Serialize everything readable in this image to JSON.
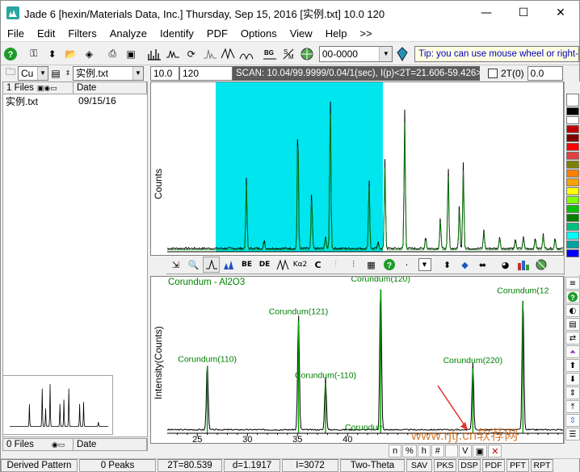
{
  "window": {
    "title": "Jade 6 [hexin/Materials Data, Inc.] Thursday, Sep 15, 2016 [实例.txt] 10.0      120"
  },
  "menu": [
    "File",
    "Edit",
    "Filters",
    "Analyze",
    "Identify",
    "PDF",
    "Options",
    "View",
    "Help",
    ">>"
  ],
  "toolbar": {
    "pdf_combo": "00-0000",
    "tip": "Tip: you can use mouse wheel or right-drag"
  },
  "left": {
    "element_combo": "Cu",
    "file_combo": "实例.txt",
    "files_header": {
      "count": "1 Files",
      "date": "Date"
    },
    "files": [
      {
        "name": "实例.txt",
        "date": "09/15/16"
      }
    ],
    "files2_header": {
      "count": "0 Files",
      "date": "Date"
    }
  },
  "scan": {
    "start": "10.0",
    "end": "120",
    "info": "SCAN: 10.04/99.9999/0.04/1(sec), I(p)<2T=21.606-59.426>",
    "twotheta_label": "2T(0)",
    "twotheta_value": "0.0"
  },
  "top_plot": {
    "ylabel": "Counts"
  },
  "bottom_plot": {
    "ylabel": "Intensity(Counts)",
    "phase_label": "Corundum - Al2O3",
    "peaks": [
      {
        "label": "Corundum(110)",
        "x": 26.0,
        "h": 0.46
      },
      {
        "label": "Corundum(121)",
        "x": 35.1,
        "h": 0.78
      },
      {
        "label": "Corundum(-110)",
        "x": 37.8,
        "h": 0.35
      },
      {
        "label": "Corundum(120)",
        "x": 43.3,
        "h": 1.0
      },
      {
        "label": "Corundum(220)",
        "x": 52.5,
        "h": 0.45
      },
      {
        "label": "Corundum(12",
        "x": 57.5,
        "h": 0.92
      }
    ],
    "partial_label": "Corundum",
    "xticks": [
      25,
      30,
      35,
      40
    ]
  },
  "bottom_tools": [
    "n",
    "%",
    "h",
    "#",
    "",
    "V",
    "",
    ""
  ],
  "bottom_tabs": [
    "SAV",
    "PKS",
    "DSP",
    "PDF",
    "PFT",
    "RPT"
  ],
  "status": {
    "pattern": "Derived Pattern",
    "peaks": "0 Peaks",
    "twotheta": "2T=80.539",
    "d": "d=1.1917",
    "i": "I=3072",
    "axis": "Two-Theta"
  },
  "watermark": "www.rjtj.cn软荐网",
  "colors": {
    "highlight": "#00e5ee",
    "pattern": "#000000",
    "phase": "#008000"
  }
}
